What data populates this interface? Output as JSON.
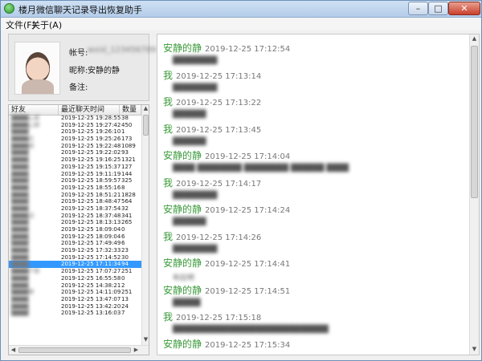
{
  "window": {
    "title": "楼月微信聊天记录导出恢复助手",
    "minimize_glyph": "–",
    "maximize_glyph": "□",
    "close_glyph": "✕"
  },
  "menu": [
    "文件(F)",
    "关于(A)"
  ],
  "profile": {
    "account_label": "帐号:",
    "account_value": "wxid_123456789",
    "nickname_label": "昵称:",
    "nickname_value": "安静的静",
    "remark_label": "备注:",
    "remark_value": ""
  },
  "contacts": {
    "columns": [
      "好友",
      "最近聊天时间",
      "数量"
    ],
    "selected_index": 21,
    "rows": [
      {
        "name": "████心群",
        "time": "2019-12-25 19:28:55",
        "count": "38"
      },
      {
        "name": "████心群",
        "time": "2019-12-25 19:27:42",
        "count": "450"
      },
      {
        "name": "████",
        "time": "2019-12-25 19:26:10",
        "count": "1"
      },
      {
        "name": "████庄",
        "time": "2019-12-25 19:25:26",
        "count": "173"
      },
      {
        "name": "████统",
        "time": "2019-12-25 19:22:48",
        "count": "1089"
      },
      {
        "name": "████",
        "time": "2019-12-25 19:22:02",
        "count": "93"
      },
      {
        "name": "████",
        "time": "2019-12-25 19:16:25",
        "count": "1321"
      },
      {
        "name": "████",
        "time": "2019-12-25 19:15:37",
        "count": "127"
      },
      {
        "name": "████",
        "time": "2019-12-25 19:11:19",
        "count": "144"
      },
      {
        "name": "████",
        "time": "2019-12-25 18:59:57",
        "count": "325"
      },
      {
        "name": "████",
        "time": "2019-12-25 18:55:16",
        "count": "8"
      },
      {
        "name": "████",
        "time": "2019-12-25 18:51:21",
        "count": "1828"
      },
      {
        "name": "████",
        "time": "2019-12-25 18:48:47",
        "count": "564"
      },
      {
        "name": "████",
        "time": "2019-12-25 18:37:54",
        "count": "32"
      },
      {
        "name": "████活",
        "time": "2019-12-25 18:37:48",
        "count": "341"
      },
      {
        "name": "████",
        "time": "2019-12-25 18:13:13",
        "count": "265"
      },
      {
        "name": "████",
        "time": "2019-12-25 18:09:04",
        "count": "0"
      },
      {
        "name": "████",
        "time": "2019-12-25 18:09:04",
        "count": "6"
      },
      {
        "name": "████",
        "time": "2019-12-25 17:49:49",
        "count": "6"
      },
      {
        "name": "████",
        "time": "2019-12-25 17:32:33",
        "count": "23"
      },
      {
        "name": "████",
        "time": "2019-12-25 17:14:52",
        "count": "30"
      },
      {
        "name": "████",
        "time": "2019-12-25 17:11:34",
        "count": "94"
      },
      {
        "name": "████户群",
        "time": "2019-12-25 17:07:27",
        "count": "251"
      },
      {
        "name": "████",
        "time": "2019-12-25 16:55:58",
        "count": "0"
      },
      {
        "name": "████",
        "time": "2019-12-25 14:38:21",
        "count": "2"
      },
      {
        "name": "████群",
        "time": "2019-12-25 14:11:09",
        "count": "251"
      },
      {
        "name": "████",
        "time": "2019-12-25 13:47:07",
        "count": "13"
      },
      {
        "name": "████",
        "time": "2019-12-25 13:42:20",
        "count": "24"
      },
      {
        "name": "████",
        "time": "2019-12-25 13:16:03",
        "count": "7"
      }
    ]
  },
  "chat": {
    "messages": [
      {
        "sender": "安静的静",
        "time": "2019-12-25 17:12:54",
        "content": "████████"
      },
      {
        "sender": "我",
        "time": "2019-12-25 17:13:14",
        "content": "████████"
      },
      {
        "sender": "我",
        "time": "2019-12-25 17:13:22",
        "content": "██████"
      },
      {
        "sender": "我",
        "time": "2019-12-25 17:13:45",
        "content": "██████"
      },
      {
        "sender": "安静的静",
        "time": "2019-12-25 17:14:04",
        "content": "████ ████████ ████████ ██████ ████"
      },
      {
        "sender": "我",
        "time": "2019-12-25 17:14:17",
        "content": "████████"
      },
      {
        "sender": "安静的静",
        "time": "2019-12-25 17:14:24",
        "content": "██████"
      },
      {
        "sender": "我",
        "time": "2019-12-25 17:14:26",
        "content": "████████"
      },
      {
        "sender": "安静的静",
        "time": "2019-12-25 17:14:41",
        "content": "布拉吧"
      },
      {
        "sender": "安静的静",
        "time": "2019-12-25 17:14:51",
        "content": "█████"
      },
      {
        "sender": "我",
        "time": "2019-12-25 17:15:18",
        "content": "████████████████████████████"
      },
      {
        "sender": "安静的静",
        "time": "2019-12-25 17:15:34",
        "content": ""
      }
    ]
  }
}
